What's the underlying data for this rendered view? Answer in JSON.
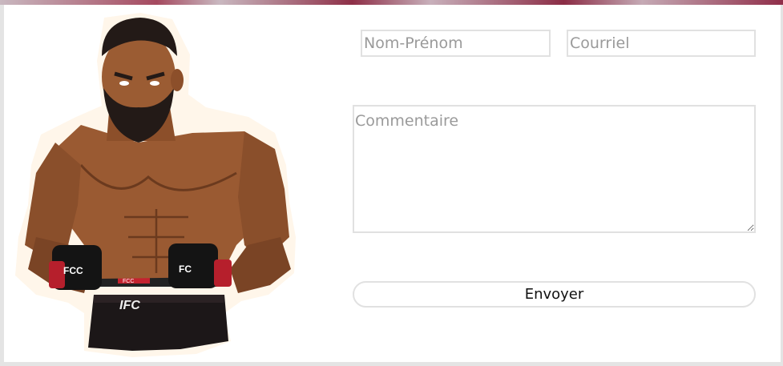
{
  "form": {
    "name_placeholder": "Nom-Prénom",
    "email_placeholder": "Courriel",
    "comment_placeholder": "Commentaire",
    "submit_label": "Envoyer"
  },
  "illustration": {
    "shorts_logo": "IFC",
    "glove_left_text": "FCC",
    "glove_right_text": "FC",
    "waistband_text": "FCC"
  },
  "colors": {
    "page_bg": "#e4e4e4",
    "card_bg": "#ffffff",
    "field_border": "#e1e1e1",
    "placeholder": "#9a9a9a",
    "accent": "#8e2f47"
  }
}
